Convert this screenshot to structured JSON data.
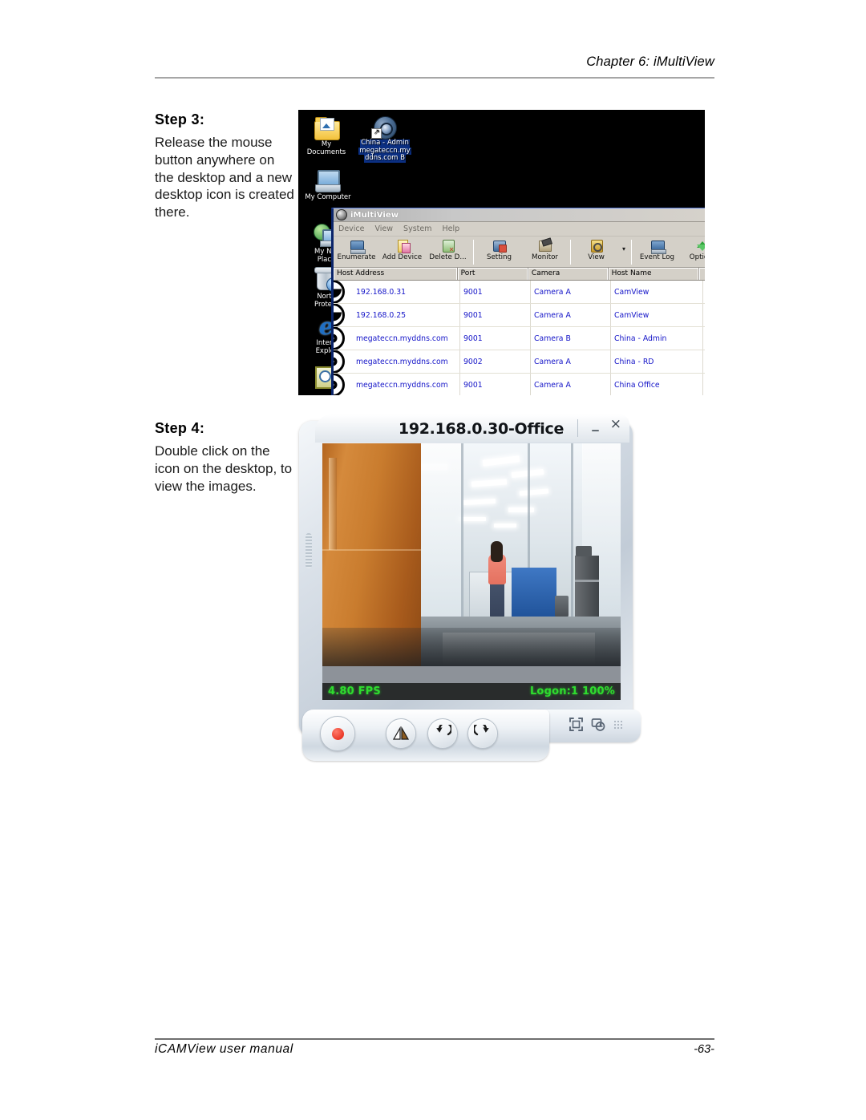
{
  "page": {
    "header_chapter": "Chapter 6: iMultiView",
    "footer_manual": "iCAMView user manual",
    "footer_page": "-63-"
  },
  "steps": [
    {
      "title": "Step 3:",
      "body": "Release the mouse button anywhere on the desktop and a new desktop icon is created there."
    },
    {
      "title": "Step 4:",
      "body": "Double click on the icon on the desktop, to view the images."
    }
  ],
  "desktop": {
    "icons": [
      {
        "name": "my-documents",
        "label": "My Documents",
        "selected": false
      },
      {
        "name": "camera-shortcut",
        "label": "China - Admin megateccn.myddns.com B",
        "selected": true
      },
      {
        "name": "my-computer",
        "label": "My Computer",
        "selected": false
      },
      {
        "name": "my-network-places",
        "label": "My Net\nPlace",
        "selected": false
      },
      {
        "name": "norton-protected",
        "label": "Norto\nProtect",
        "selected": false
      },
      {
        "name": "internet-explorer",
        "label": "Intern\nExplor",
        "selected": false
      }
    ],
    "shortcut_label_lines": [
      "China - Admin",
      "megateccn.my",
      "ddns.com B"
    ]
  },
  "imultiview": {
    "window_title": "iMultiView",
    "menu": [
      "Device",
      "View",
      "System",
      "Help"
    ],
    "toolbar": [
      {
        "name": "enumerate",
        "label": "Enumerate"
      },
      {
        "name": "add-device",
        "label": "Add Device"
      },
      {
        "name": "delete-device",
        "label": "Delete D..."
      },
      {
        "name": "setting",
        "label": "Setting"
      },
      {
        "name": "monitor",
        "label": "Monitor"
      },
      {
        "name": "view",
        "label": "View"
      },
      {
        "name": "event-log",
        "label": "Event Log"
      },
      {
        "name": "options",
        "label": "Options"
      }
    ],
    "grid": {
      "columns": [
        "Host Address",
        "Port",
        "Camera",
        "Host Name"
      ],
      "rows": [
        {
          "host": "192.168.0.31",
          "port": "9001",
          "camera": "Camera A",
          "hostname": "CamView",
          "icon": "camera-closed-icon"
        },
        {
          "host": "192.168.0.25",
          "port": "9001",
          "camera": "Camera A",
          "hostname": "CamView",
          "icon": "camera-closed-icon"
        },
        {
          "host": "megateccn.myddns.com",
          "port": "9001",
          "camera": "Camera B",
          "hostname": "China - Admin",
          "icon": "camera-open-icon"
        },
        {
          "host": "megateccn.myddns.com",
          "port": "9002",
          "camera": "Camera A",
          "hostname": "China - RD",
          "icon": "camera-open-icon"
        },
        {
          "host": "megateccn.myddns.com",
          "port": "9001",
          "camera": "Camera A",
          "hostname": "China Office",
          "icon": "camera-open-icon"
        }
      ]
    }
  },
  "camera_viewer": {
    "title": "192.168.0.30-Office",
    "minimize_label": "_",
    "close_label": "×",
    "osd_fps": "4.80 FPS",
    "osd_logon": "Logon:1 100%",
    "controls": [
      {
        "name": "record",
        "label": "record-button"
      },
      {
        "name": "mirror",
        "label": "mirror-button"
      },
      {
        "name": "rotate-left",
        "label": "rotate-left-button"
      },
      {
        "name": "rotate-right",
        "label": "rotate-right-button"
      },
      {
        "name": "fullscreen",
        "label": "fullscreen-button"
      },
      {
        "name": "snapshot",
        "label": "snapshot-button"
      }
    ]
  }
}
